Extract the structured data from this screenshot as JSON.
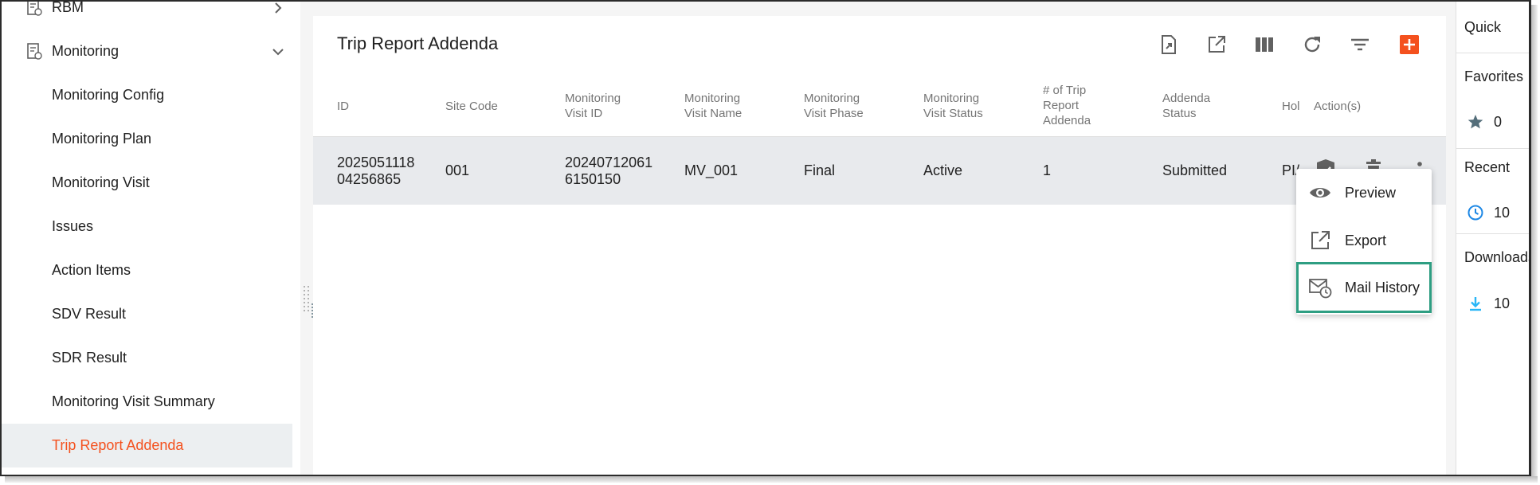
{
  "sidebar": {
    "items": [
      {
        "label": "RBM",
        "has_icon": true,
        "chevron": "right"
      },
      {
        "label": "Monitoring",
        "has_icon": true,
        "chevron": "down"
      },
      {
        "label": "Monitoring Config"
      },
      {
        "label": "Monitoring Plan"
      },
      {
        "label": "Monitoring Visit"
      },
      {
        "label": "Issues"
      },
      {
        "label": "Action Items"
      },
      {
        "label": "SDV Result"
      },
      {
        "label": "SDR Result"
      },
      {
        "label": "Monitoring Visit Summary"
      },
      {
        "label": "Trip Report Addenda",
        "active": true
      }
    ]
  },
  "page": {
    "title": "Trip Report Addenda",
    "toolbar_icons": [
      "pdf-export-icon",
      "open-external-icon",
      "columns-icon",
      "refresh-icon",
      "filter-icon",
      "add-icon"
    ]
  },
  "table": {
    "columns": [
      [
        "ID"
      ],
      [
        "Site Code"
      ],
      [
        "Monitoring",
        "Visit ID"
      ],
      [
        "Monitoring",
        "Visit Name"
      ],
      [
        "Monitoring",
        "Visit Phase"
      ],
      [
        "Monitoring",
        "Visit Status"
      ],
      [
        "# of Trip",
        "Report",
        "Addenda"
      ],
      [
        "Addenda",
        "Status"
      ],
      [
        "Hol"
      ],
      [
        "Action(s)"
      ]
    ],
    "rows": [
      {
        "id": [
          "2025051118",
          "04256865"
        ],
        "site_code": "001",
        "visit_id": [
          "20240712061",
          "6150150"
        ],
        "visit_name": "MV_001",
        "visit_phase": "Final",
        "visit_status": "Active",
        "addenda_count": "1",
        "addenda_status": "Submitted",
        "hol": "PI/"
      }
    ]
  },
  "menu": {
    "items": [
      {
        "label": "Preview",
        "icon": "eye-icon"
      },
      {
        "label": "Export",
        "icon": "open-external-icon"
      },
      {
        "label": "Mail History",
        "icon": "mail-clock-icon",
        "highlighted": true
      }
    ]
  },
  "quick_panel": {
    "title": "Quick",
    "favorites": {
      "label": "Favorites",
      "count": "0"
    },
    "recent": {
      "label": "Recent",
      "count": "10"
    },
    "downloads": {
      "label": "Downloads",
      "count": "10"
    }
  },
  "colors": {
    "accent": "#f4511e",
    "highlight_border": "#2e9e82",
    "row_bg": "#e8eaed",
    "icon_gray": "#616161",
    "download_blue": "#29b6f6",
    "clock_blue": "#1e88e5"
  }
}
